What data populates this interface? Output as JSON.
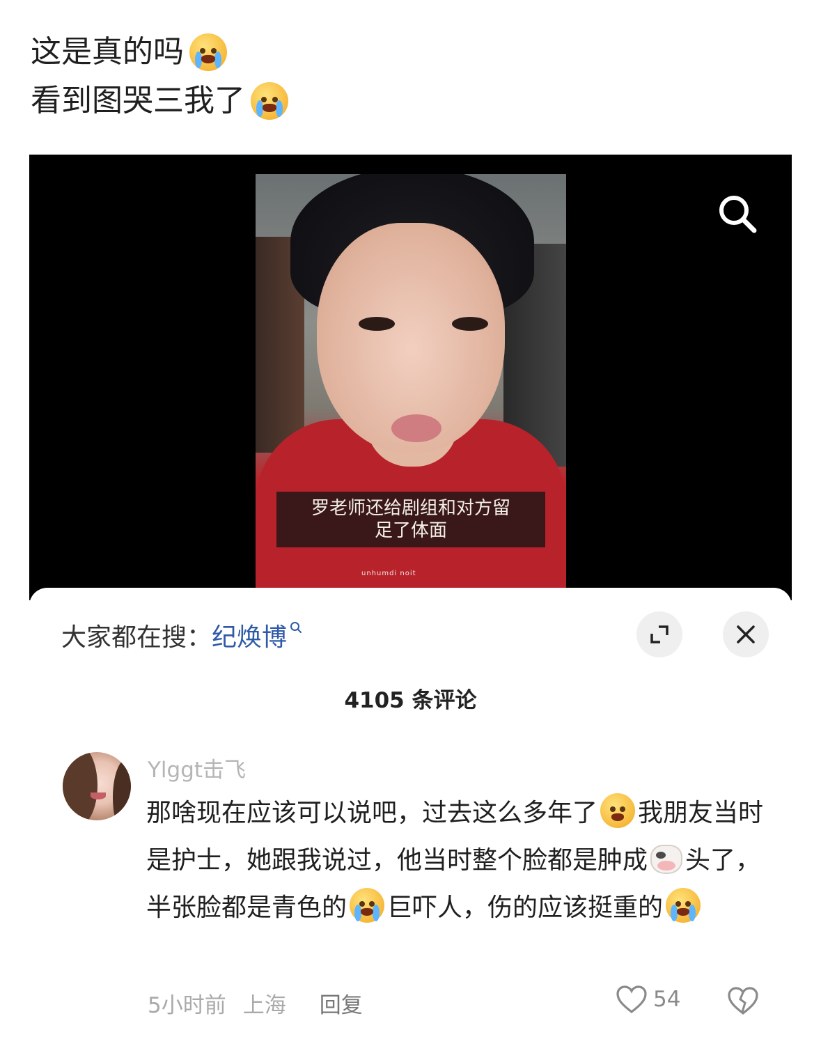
{
  "post": {
    "line1": "这是真的吗",
    "line1_emoji": "pleading-tears-emoji",
    "line2": "看到图哭三我了",
    "line2_emoji": "loudly-crying-emoji"
  },
  "video": {
    "subtitle_line1": "罗老师还给剧组和对方留",
    "subtitle_line2": "足了体面",
    "shirt_text": "unhumdi noit",
    "search_icon": "search-icon"
  },
  "panel": {
    "trending_label": "大家都在搜：",
    "trending_term": "纪焕博",
    "expand_icon": "expand-icon",
    "close_icon": "close-icon",
    "comment_count": "4105 条评论"
  },
  "comment": {
    "username": "Ylggt击飞",
    "text_1": "那啥现在应该可以说吧，过去这么多年了",
    "text_2": "我朋友当时是护士，她跟我说过，他当时整个脸都是肿成",
    "text_3": "头了，半张脸都是青色的",
    "text_4": "巨吓人，伤的应该挺重的",
    "time": "5小时前",
    "location": "上海",
    "reply_label": "回复",
    "like_count": "54",
    "like_icon": "heart-icon",
    "dislike_icon": "broken-heart-icon"
  }
}
